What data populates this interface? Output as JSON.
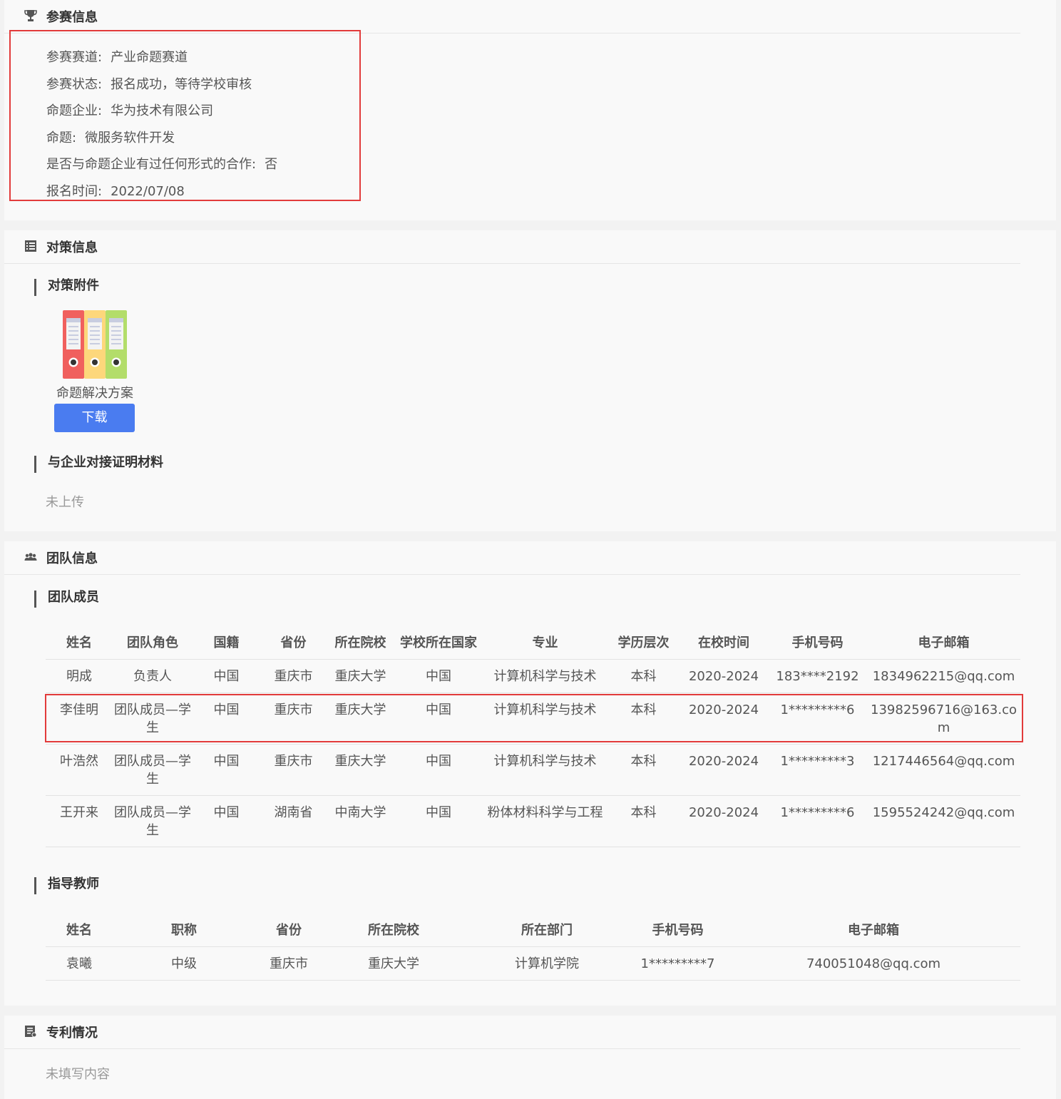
{
  "registration": {
    "title": "参赛信息",
    "icon": "trophy-icon",
    "rows": [
      {
        "label": "参赛赛道:",
        "value": "产业命题赛道"
      },
      {
        "label": "参赛状态:",
        "value": "报名成功，等待学校审核"
      },
      {
        "label": "命题企业:",
        "value": "华为技术有限公司"
      },
      {
        "label": "命题:",
        "value": "微服务软件开发"
      },
      {
        "label": "是否与命题企业有过任何形式的合作:",
        "value": "否"
      },
      {
        "label": "报名时间:",
        "value": "2022/07/08"
      }
    ]
  },
  "strategy": {
    "title": "对策信息",
    "icon": "list-icon",
    "attachment_title": "对策附件",
    "file_name": "命题解决方案",
    "download_label": "下载",
    "proof_title": "与企业对接证明材料",
    "proof_value": "未上传"
  },
  "team": {
    "title": "团队信息",
    "icon": "team-icon",
    "members_title": "团队成员",
    "member_headers": [
      "姓名",
      "团队角色",
      "国籍",
      "省份",
      "所在院校",
      "学校所在国家",
      "专业",
      "学历层次",
      "在校时间",
      "手机号码",
      "电子邮箱"
    ],
    "members": [
      [
        "明成",
        "负责人",
        "中国",
        "重庆市",
        "重庆大学",
        "中国",
        "计算机科学与技术",
        "本科",
        "2020-2024",
        "183****2192",
        "1834962215@qq.com"
      ],
      [
        "李佳明",
        "团队成员—学生",
        "中国",
        "重庆市",
        "重庆大学",
        "中国",
        "计算机科学与技术",
        "本科",
        "2020-2024",
        "1*********6",
        "13982596716@163.com"
      ],
      [
        "叶浩然",
        "团队成员—学生",
        "中国",
        "重庆市",
        "重庆大学",
        "中国",
        "计算机科学与技术",
        "本科",
        "2020-2024",
        "1*********3",
        "1217446564@qq.com"
      ],
      [
        "王开来",
        "团队成员—学生",
        "中国",
        "湖南省",
        "中南大学",
        "中国",
        "粉体材料科学与工程",
        "本科",
        "2020-2024",
        "1*********6",
        "1595524242@qq.com"
      ]
    ],
    "teachers_title": "指导教师",
    "teacher_headers": [
      "姓名",
      "职称",
      "省份",
      "所在院校",
      "所在部门",
      "手机号码",
      "电子邮箱"
    ],
    "teachers": [
      [
        "袁曦",
        "中级",
        "重庆市",
        "重庆大学",
        "计算机学院",
        "1*********7",
        "740051048@qq.com"
      ]
    ]
  },
  "patent": {
    "title": "专利情况",
    "icon": "certificate-icon",
    "value": "未填写内容"
  },
  "colors": {
    "highlight": "#e23b3b",
    "button": "#4a7cf0",
    "binder_red": "#f0605e",
    "binder_yellow": "#fdd77b",
    "binder_green": "#b3dd6a"
  }
}
